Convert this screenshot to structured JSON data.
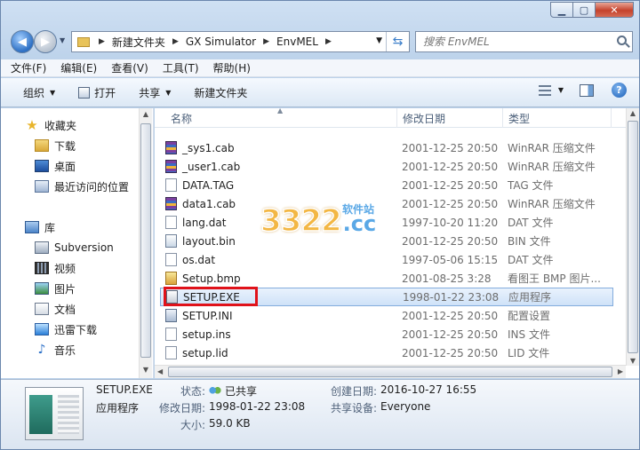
{
  "address": {
    "breadcrumbs": [
      "新建文件夹",
      "GX Simulator",
      "EnvMEL"
    ]
  },
  "search": {
    "placeholder": "搜索 EnvMEL"
  },
  "menu": [
    "文件(F)",
    "编辑(E)",
    "查看(V)",
    "工具(T)",
    "帮助(H)"
  ],
  "toolbar": {
    "organize": "组织",
    "open": "打开",
    "share": "共享",
    "new_folder": "新建文件夹"
  },
  "nav": {
    "favorites": "收藏夹",
    "downloads": "下载",
    "desktop": "桌面",
    "recent": "最近访问的位置",
    "libraries": "库",
    "subversion": "Subversion",
    "videos": "视频",
    "pictures": "图片",
    "documents": "文档",
    "xunlei": "迅雷下载",
    "music": "音乐"
  },
  "columns": {
    "name": "名称",
    "date": "修改日期",
    "type": "类型"
  },
  "files": [
    {
      "name": "_sys1.cab",
      "date": "2001-12-25 20:50",
      "type": "WinRAR 压缩文件",
      "icon": "winrar-icon"
    },
    {
      "name": "_user1.cab",
      "date": "2001-12-25 20:50",
      "type": "WinRAR 压缩文件",
      "icon": "winrar-icon"
    },
    {
      "name": "DATA.TAG",
      "date": "2001-12-25 20:50",
      "type": "TAG 文件",
      "icon": "file-icon"
    },
    {
      "name": "data1.cab",
      "date": "2001-12-25 20:50",
      "type": "WinRAR 压缩文件",
      "icon": "winrar-icon"
    },
    {
      "name": "lang.dat",
      "date": "1997-10-20 11:20",
      "type": "DAT 文件",
      "icon": "file-icon"
    },
    {
      "name": "layout.bin",
      "date": "2001-12-25 20:50",
      "type": "BIN 文件",
      "icon": "config-icon"
    },
    {
      "name": "os.dat",
      "date": "1997-05-06 15:15",
      "type": "DAT 文件",
      "icon": "file-icon"
    },
    {
      "name": "Setup.bmp",
      "date": "2001-08-25 3:28",
      "type": "看图王 BMP 图片...",
      "icon": "bmp-icon"
    },
    {
      "name": "SETUP.EXE",
      "date": "1998-01-22 23:08",
      "type": "应用程序",
      "icon": "exe-icon"
    },
    {
      "name": "SETUP.INI",
      "date": "2001-12-25 20:50",
      "type": "配置设置",
      "icon": "ini-icon"
    },
    {
      "name": "setup.ins",
      "date": "2001-12-25 20:50",
      "type": "INS 文件",
      "icon": "file-icon"
    },
    {
      "name": "setup.lid",
      "date": "2001-12-25 20:50",
      "type": "LID 文件",
      "icon": "file-icon"
    }
  ],
  "watermark": {
    "big": "3322",
    "cc": ".cc",
    "small": "软件站"
  },
  "details": {
    "filename": "SETUP.EXE",
    "filetype": "应用程序",
    "state_label": "状态:",
    "state_value": "已共享",
    "modified_label": "修改日期:",
    "modified_value": "1998-01-22 23:08",
    "size_label": "大小:",
    "size_value": "59.0 KB",
    "created_label": "创建日期:",
    "created_value": "2016-10-27 16:55",
    "share_label": "共享设备:",
    "share_value": "Everyone"
  },
  "colors": {
    "selection_border": "#83acdd",
    "highlight_box": "#e0121a"
  }
}
